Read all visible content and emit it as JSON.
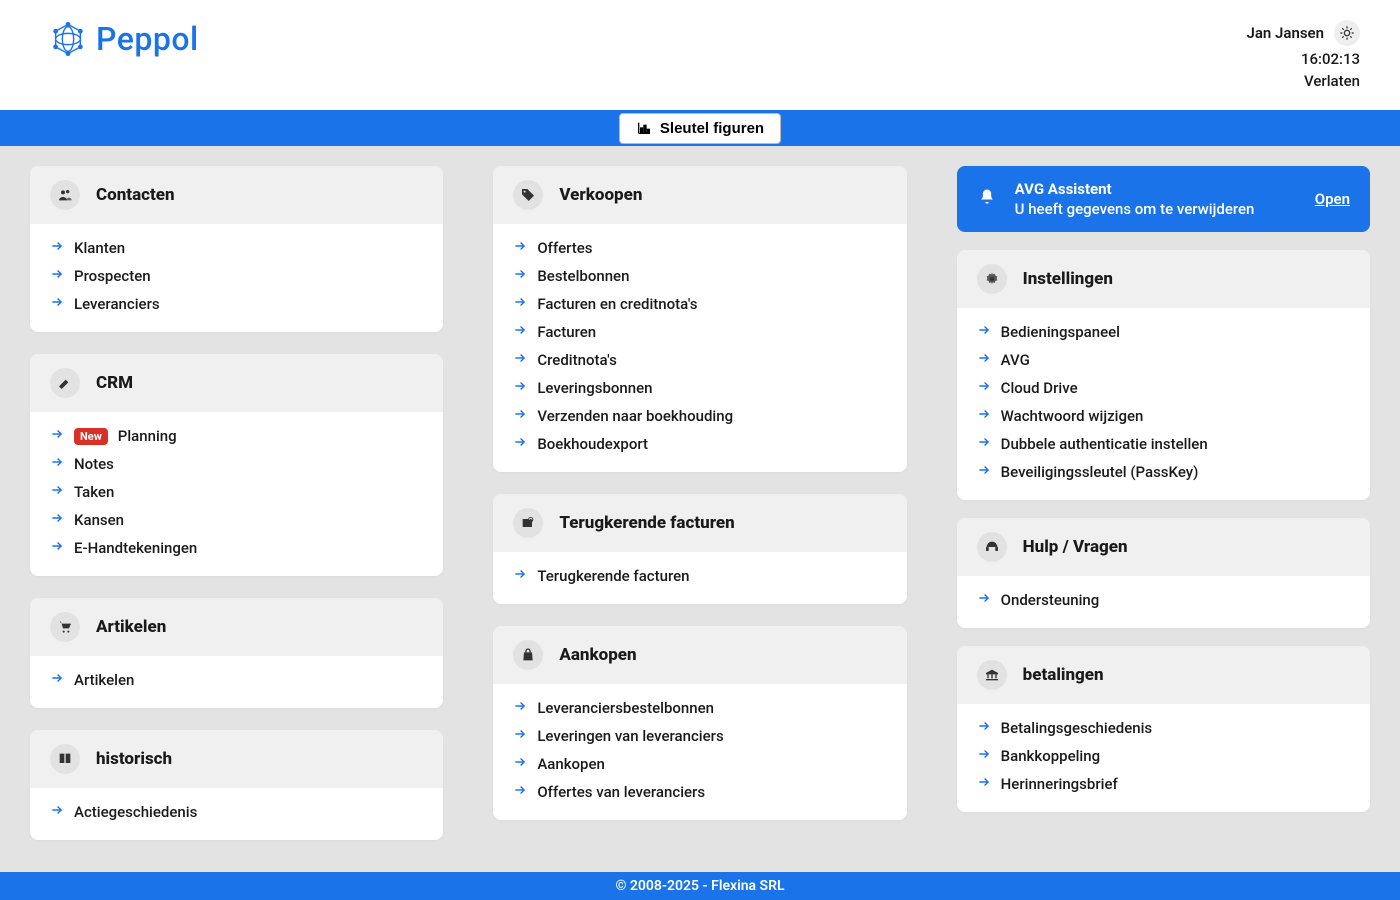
{
  "header": {
    "brand": "Peppol",
    "user": "Jan Jansen",
    "time": "16:02:13",
    "logout": "Verlaten"
  },
  "bluebar": {
    "keyfig_label": "Sleutel figuren"
  },
  "alert": {
    "title": "AVG Assistent",
    "subtitle": "U heeft gegevens om te verwijderen",
    "open": "Open"
  },
  "cards": {
    "contacten": {
      "title": "Contacten",
      "items": [
        "Klanten",
        "Prospecten",
        "Leveranciers"
      ]
    },
    "crm": {
      "title": "CRM",
      "items": [
        {
          "label": "Planning",
          "badge": "New"
        },
        {
          "label": "Notes"
        },
        {
          "label": "Taken"
        },
        {
          "label": "Kansen"
        },
        {
          "label": "E-Handtekeningen"
        }
      ]
    },
    "artikelen": {
      "title": "Artikelen",
      "items": [
        "Artikelen"
      ]
    },
    "historisch": {
      "title": "historisch",
      "items": [
        "Actiegeschiedenis"
      ]
    },
    "verkoopen": {
      "title": "Verkoopen",
      "items": [
        "Offertes",
        "Bestelbonnen",
        "Facturen en creditnota's",
        "Facturen",
        "Creditnota's",
        "Leveringsbonnen",
        "Verzenden naar boekhouding",
        "Boekhoudexport"
      ]
    },
    "terugkerend": {
      "title": "Terugkerende facturen",
      "items": [
        "Terugkerende facturen"
      ]
    },
    "aankopen": {
      "title": "Aankopen",
      "items": [
        "Leveranciersbestelbonnen",
        "Leveringen van leveranciers",
        "Aankopen",
        "Offertes van leveranciers"
      ]
    },
    "instellingen": {
      "title": "Instellingen",
      "items": [
        "Bedieningspaneel",
        "AVG",
        "Cloud Drive",
        "Wachtwoord wijzigen",
        "Dubbele authenticatie instellen",
        "Beveiligingssleutel (PassKey)"
      ]
    },
    "hulp": {
      "title": "Hulp / Vragen",
      "items": [
        "Ondersteuning"
      ]
    },
    "betalingen": {
      "title": "betalingen",
      "items": [
        "Betalingsgeschiedenis",
        "Bankkoppeling",
        "Herinneringsbrief"
      ]
    }
  },
  "footer": "© 2008-2025 - Flexina SRL"
}
